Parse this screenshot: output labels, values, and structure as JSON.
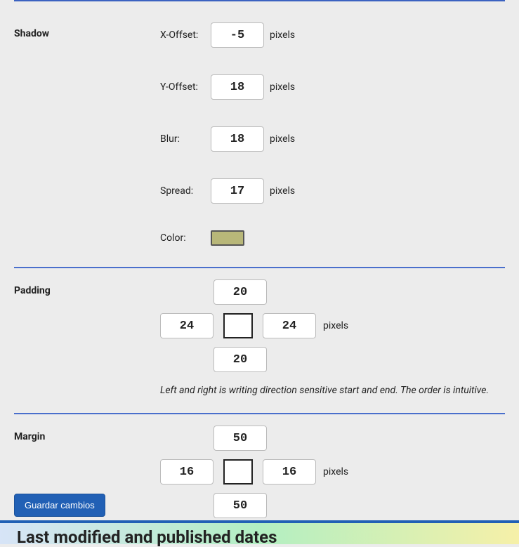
{
  "sections": {
    "shadow": {
      "label": "Shadow",
      "x_offset": {
        "label": "X-Offset:",
        "value": "-5",
        "unit": "pixels"
      },
      "y_offset": {
        "label": "Y-Offset:",
        "value": "18",
        "unit": "pixels"
      },
      "blur": {
        "label": "Blur:",
        "value": "18",
        "unit": "pixels"
      },
      "spread": {
        "label": "Spread:",
        "value": "17",
        "unit": "pixels"
      },
      "color": {
        "label": "Color:",
        "value": "#b8b779"
      }
    },
    "padding": {
      "label": "Padding",
      "top": "20",
      "left": "24",
      "right": "24",
      "bottom": "20",
      "unit": "pixels",
      "hint": "Left and right is writing direction sensitive start and end. The order is intuitive."
    },
    "margin": {
      "label": "Margin",
      "top": "50",
      "left": "16",
      "right": "16",
      "bottom": "50",
      "unit": "pixels"
    }
  },
  "save_button": "Guardar cambios",
  "footer_heading": "Last modified and published dates"
}
